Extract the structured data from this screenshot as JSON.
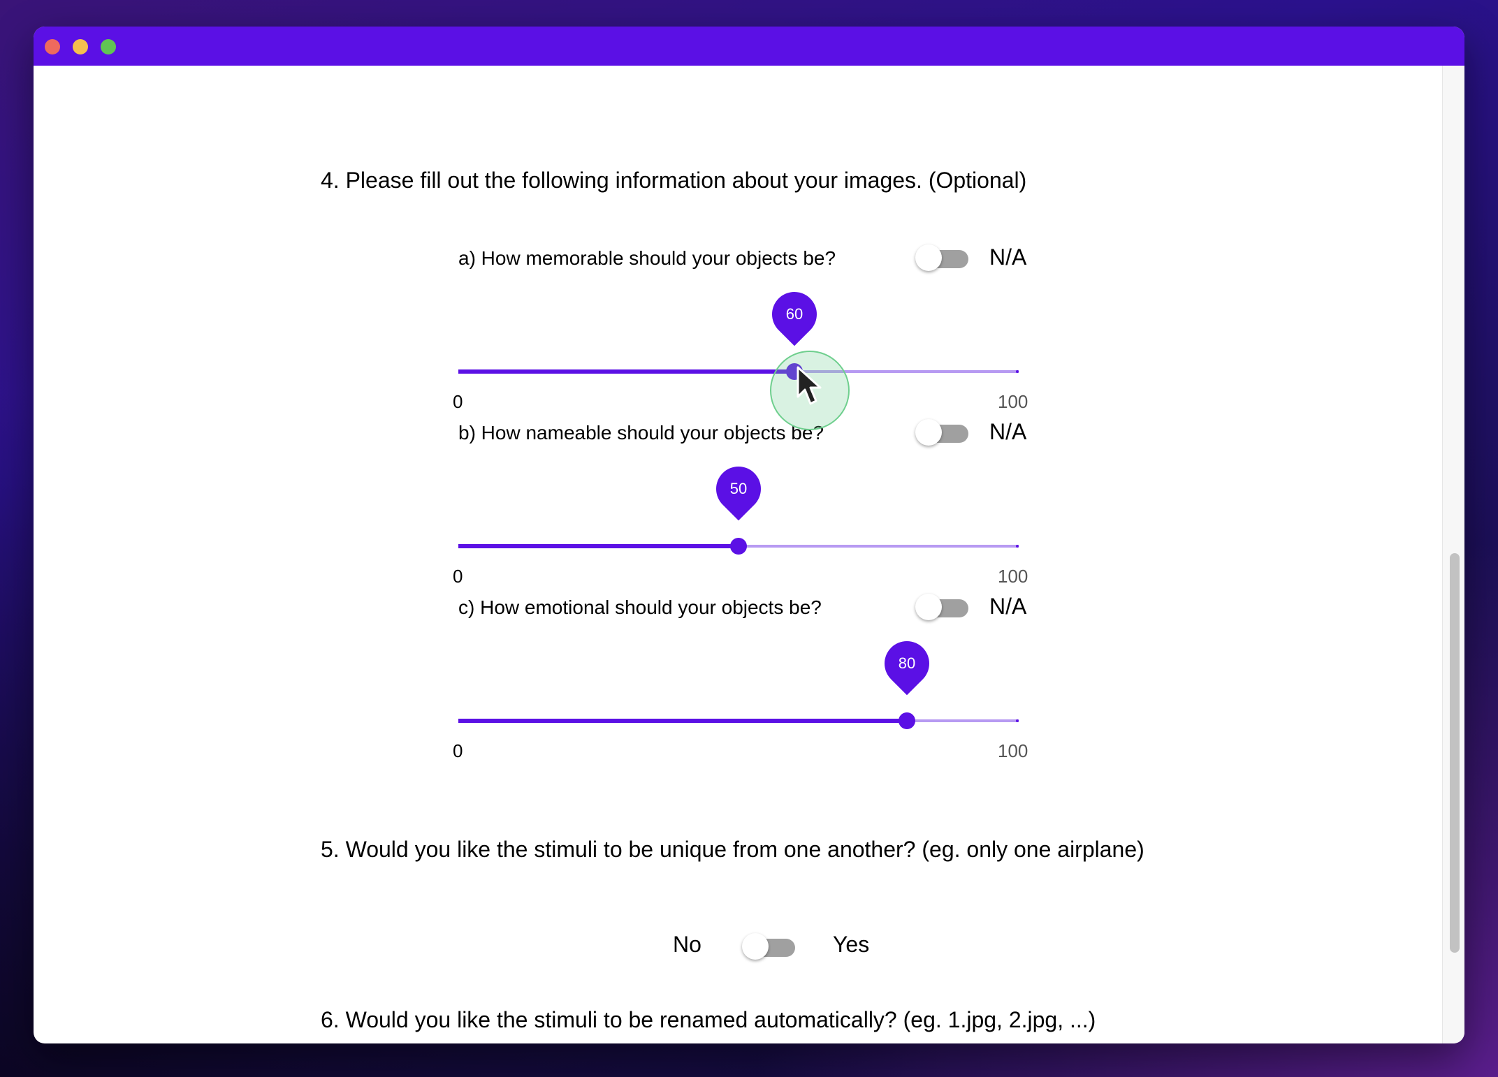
{
  "window": {
    "controls": [
      "close",
      "minimize",
      "zoom"
    ]
  },
  "question4": {
    "title": "4. Please fill out the following information about your images. (Optional)",
    "sliders": [
      {
        "question": "a) How memorable should your objects be?",
        "na_label": "N/A",
        "value_label": "60",
        "value": 60,
        "min_label": "0",
        "max_label": "100"
      },
      {
        "question": "b) How nameable should your objects be?",
        "na_label": "N/A",
        "value_label": "50",
        "value": 50,
        "min_label": "0",
        "max_label": "100"
      },
      {
        "question": "c) How emotional should your objects be?",
        "na_label": "N/A",
        "value_label": "80",
        "value": 80,
        "min_label": "0",
        "max_label": "100"
      }
    ]
  },
  "question5": {
    "title": "5. Would you like the stimuli to be unique from one another? (eg. only one airplane)",
    "no_label": "No",
    "yes_label": "Yes"
  },
  "question6": {
    "title": "6. Would you like the stimuli to be renamed automatically? (eg. 1.jpg, 2.jpg, ...)"
  },
  "colors": {
    "accent": "#5b10e5",
    "rail": "#b79af2",
    "toggle_off": "#a0a0a0"
  }
}
